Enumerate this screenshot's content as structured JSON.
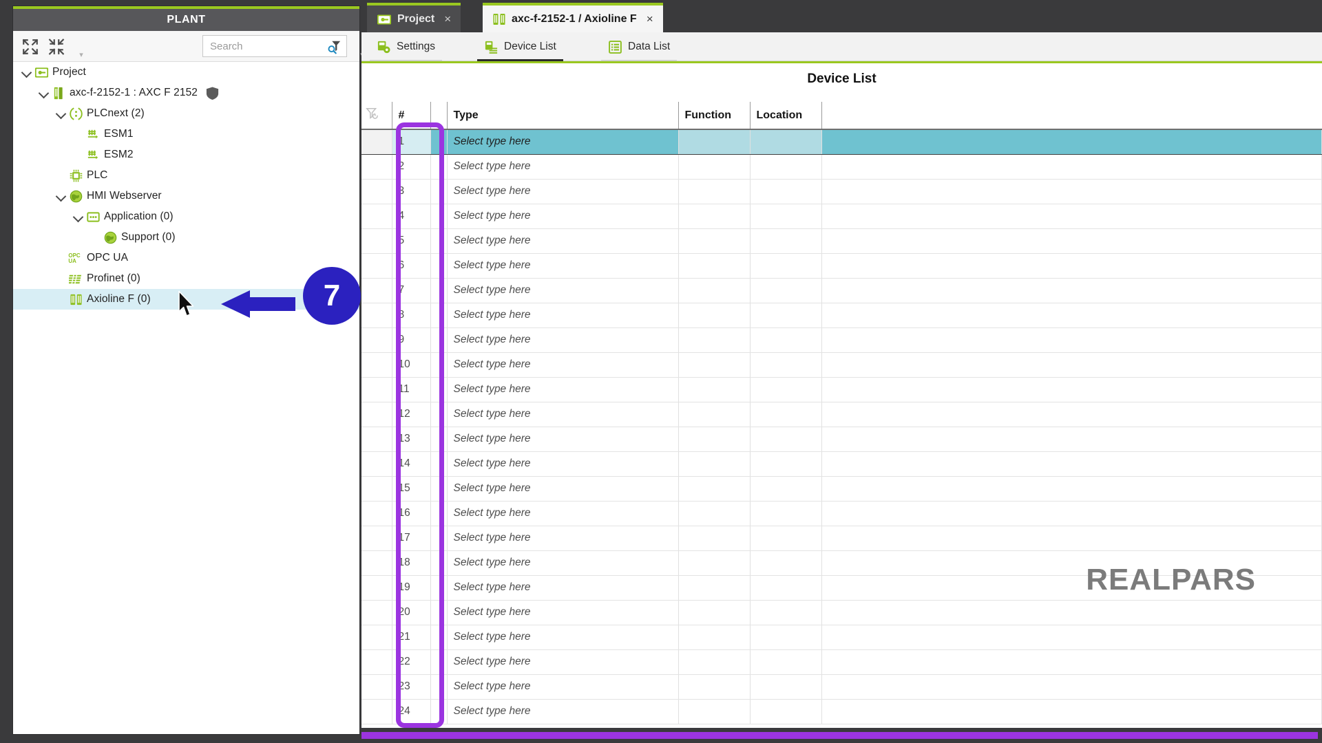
{
  "plant": {
    "header_title": "PLANT",
    "toolbar": {
      "expand_all_tooltip": "Expand all",
      "collapse_all_tooltip": "Collapse all",
      "search_placeholder": "Search",
      "search_value": ""
    },
    "tree": [
      {
        "label": "Project",
        "icon": "project-folder-icon",
        "depth": 0,
        "chevron": "expanded",
        "selected": false,
        "badge": ""
      },
      {
        "label": "axc-f-2152-1 : AXC F 2152",
        "icon": "controller-icon",
        "depth": 1,
        "chevron": "expanded",
        "selected": false,
        "badge": "shield-icon"
      },
      {
        "label": "PLCnext (2)",
        "icon": "plcnext-icon",
        "depth": 2,
        "chevron": "expanded",
        "selected": false,
        "badge": ""
      },
      {
        "label": "ESM1",
        "icon": "esm-icon",
        "depth": 3,
        "chevron": "none",
        "selected": false,
        "badge": ""
      },
      {
        "label": "ESM2",
        "icon": "esm-icon",
        "depth": 3,
        "chevron": "none",
        "selected": false,
        "badge": ""
      },
      {
        "label": "PLC",
        "icon": "chip-icon",
        "depth": 2,
        "chevron": "none",
        "selected": false,
        "badge": ""
      },
      {
        "label": "HMI Webserver",
        "icon": "globe-icon",
        "depth": 2,
        "chevron": "expanded",
        "selected": false,
        "badge": ""
      },
      {
        "label": "Application (0)",
        "icon": "application-icon",
        "depth": 3,
        "chevron": "expanded",
        "selected": false,
        "badge": ""
      },
      {
        "label": "Support (0)",
        "icon": "globe-icon",
        "depth": 4,
        "chevron": "none",
        "selected": false,
        "badge": ""
      },
      {
        "label": "OPC UA",
        "icon": "opc-ua-icon",
        "depth": 2,
        "chevron": "none",
        "selected": false,
        "badge": ""
      },
      {
        "label": "Profinet (0)",
        "icon": "profinet-icon",
        "depth": 2,
        "chevron": "none",
        "selected": false,
        "badge": ""
      },
      {
        "label": "Axioline F (0)",
        "icon": "axioline-icon",
        "depth": 2,
        "chevron": "none",
        "selected": true,
        "badge": ""
      }
    ]
  },
  "annotation": {
    "step_number": "7",
    "badge_color": "#2b21bf",
    "arrow_color": "#2b21bf",
    "highlight_color": "#9b34e0"
  },
  "editor": {
    "tabs": [
      {
        "label": "Project",
        "icon": "project-folder-icon",
        "active": false,
        "close": "×"
      },
      {
        "label": "axc-f-2152-1 / Axioline F",
        "icon": "axioline-icon",
        "active": true,
        "close": "×"
      }
    ],
    "subtabs": [
      {
        "label": "Settings",
        "icon": "settings-icon",
        "active": false
      },
      {
        "label": "Device List",
        "icon": "device-list-icon",
        "active": true
      },
      {
        "label": "Data List",
        "icon": "data-list-icon",
        "active": false
      }
    ],
    "content_title": "Device List",
    "grid": {
      "columns": [
        "",
        "#",
        "",
        "Type",
        "Function",
        "Location",
        ""
      ],
      "filter_icon": "filter-icon",
      "placeholder_cell": "Select type here",
      "selected_row": 1,
      "rows": [
        {
          "num": "1",
          "type": "Select type here",
          "function": "",
          "location": ""
        },
        {
          "num": "2",
          "type": "Select type here",
          "function": "",
          "location": ""
        },
        {
          "num": "3",
          "type": "Select type here",
          "function": "",
          "location": ""
        },
        {
          "num": "4",
          "type": "Select type here",
          "function": "",
          "location": ""
        },
        {
          "num": "5",
          "type": "Select type here",
          "function": "",
          "location": ""
        },
        {
          "num": "6",
          "type": "Select type here",
          "function": "",
          "location": ""
        },
        {
          "num": "7",
          "type": "Select type here",
          "function": "",
          "location": ""
        },
        {
          "num": "8",
          "type": "Select type here",
          "function": "",
          "location": ""
        },
        {
          "num": "9",
          "type": "Select type here",
          "function": "",
          "location": ""
        },
        {
          "num": "10",
          "type": "Select type here",
          "function": "",
          "location": ""
        },
        {
          "num": "11",
          "type": "Select type here",
          "function": "",
          "location": ""
        },
        {
          "num": "12",
          "type": "Select type here",
          "function": "",
          "location": ""
        },
        {
          "num": "13",
          "type": "Select type here",
          "function": "",
          "location": ""
        },
        {
          "num": "14",
          "type": "Select type here",
          "function": "",
          "location": ""
        },
        {
          "num": "15",
          "type": "Select type here",
          "function": "",
          "location": ""
        },
        {
          "num": "16",
          "type": "Select type here",
          "function": "",
          "location": ""
        },
        {
          "num": "17",
          "type": "Select type here",
          "function": "",
          "location": ""
        },
        {
          "num": "18",
          "type": "Select type here",
          "function": "",
          "location": ""
        },
        {
          "num": "19",
          "type": "Select type here",
          "function": "",
          "location": ""
        },
        {
          "num": "20",
          "type": "Select type here",
          "function": "",
          "location": ""
        },
        {
          "num": "21",
          "type": "Select type here",
          "function": "",
          "location": ""
        },
        {
          "num": "22",
          "type": "Select type here",
          "function": "",
          "location": ""
        },
        {
          "num": "23",
          "type": "Select type here",
          "function": "",
          "location": ""
        },
        {
          "num": "24",
          "type": "Select type here",
          "function": "",
          "location": ""
        }
      ]
    }
  },
  "watermark": {
    "text": "REALPARS"
  },
  "theme": {
    "accent_green": "#9ac820",
    "selection_teal": "#6fc2d0",
    "tree_selection": "#d8eef5",
    "chrome_dark": "#3a3a3c"
  }
}
